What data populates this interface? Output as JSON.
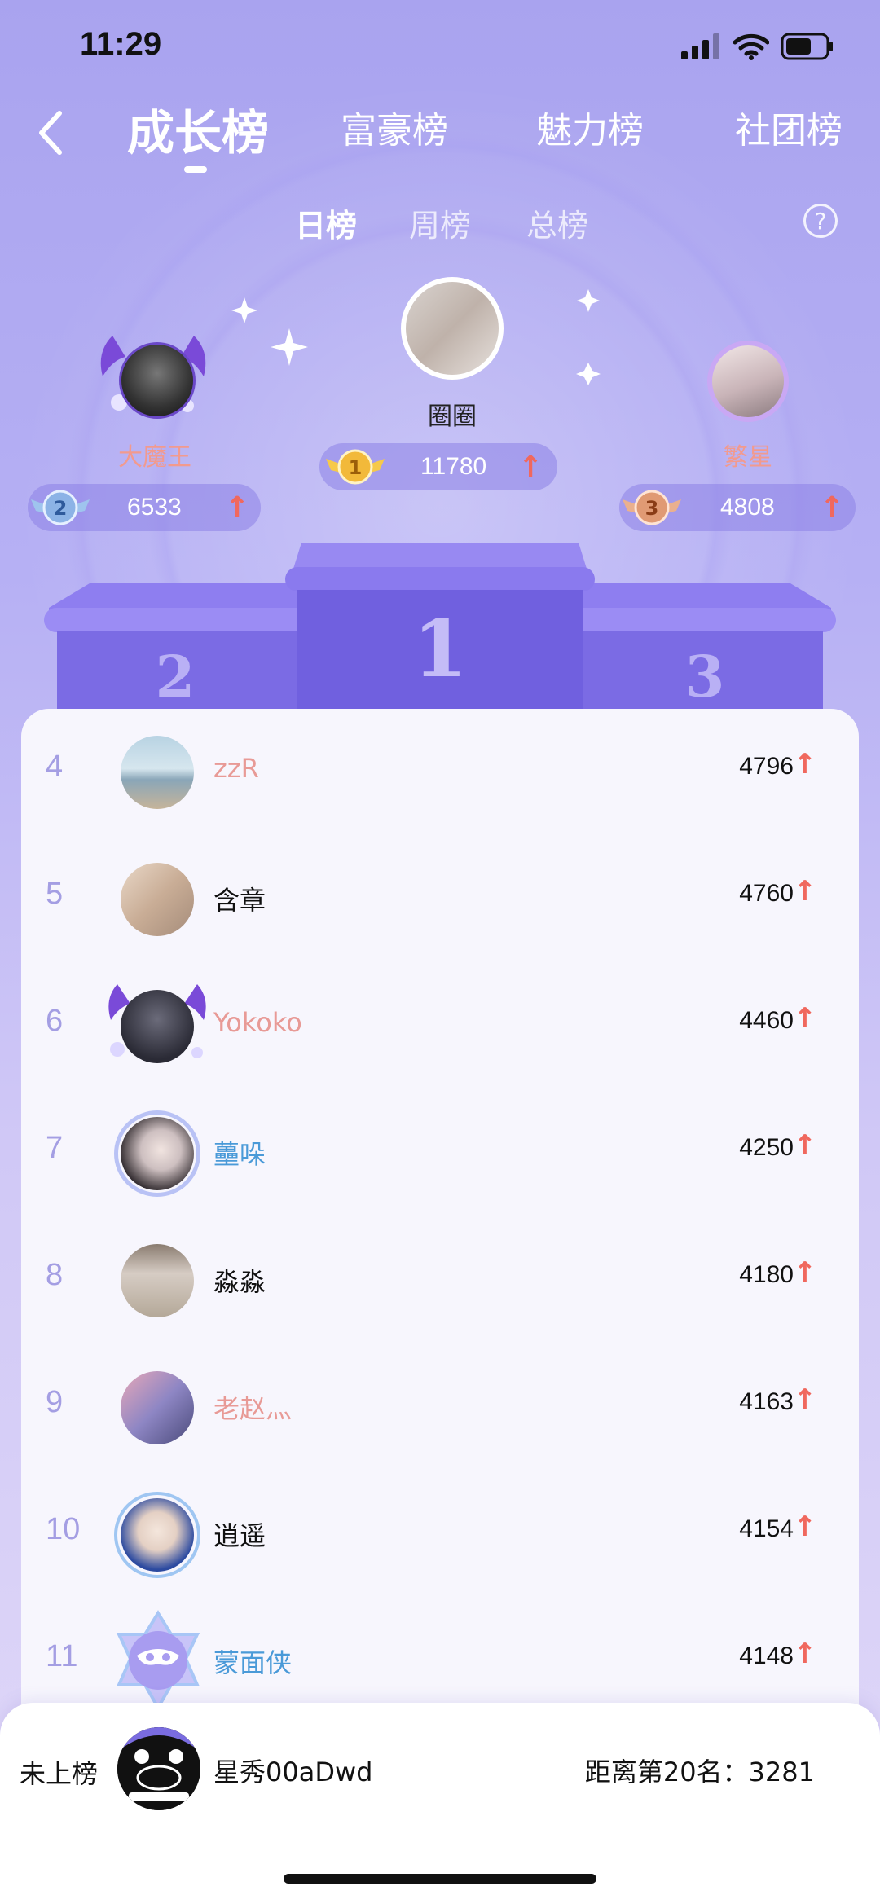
{
  "status_bar": {
    "time": "11:29",
    "icons": [
      "signal-icon",
      "wifi-icon",
      "battery-icon"
    ]
  },
  "nav": {
    "tabs": [
      {
        "label": "成长榜",
        "active": true
      },
      {
        "label": "富豪榜",
        "active": false
      },
      {
        "label": "魅力榜",
        "active": false
      },
      {
        "label": "社团榜",
        "active": false
      }
    ]
  },
  "sub_tabs": [
    {
      "label": "日榜",
      "active": true
    },
    {
      "label": "周榜",
      "active": false
    },
    {
      "label": "总榜",
      "active": false
    }
  ],
  "help": "?",
  "top3": [
    {
      "rank": "1",
      "name": "圈圈",
      "score": "11780",
      "name_color": "#ffffff"
    },
    {
      "rank": "2",
      "name": "大魔王",
      "score": "6533",
      "name_color": "#f29a8e"
    },
    {
      "rank": "3",
      "name": "繁星",
      "score": "4808",
      "name_color": "#f29a8e"
    }
  ],
  "podium": {
    "first": "1",
    "second": "2",
    "third": "3"
  },
  "list": [
    {
      "rank": "4",
      "name": "zzR",
      "score": "4796",
      "name_color": "#e89a96"
    },
    {
      "rank": "5",
      "name": "含章",
      "score": "4760",
      "name_color": "#111111"
    },
    {
      "rank": "6",
      "name": "Yokoko",
      "score": "4460",
      "name_color": "#e89a96"
    },
    {
      "rank": "7",
      "name": "蘲哚",
      "score": "4250",
      "name_color": "#4a9ad8"
    },
    {
      "rank": "8",
      "name": "淼淼",
      "score": "4180",
      "name_color": "#111111"
    },
    {
      "rank": "9",
      "name": "老赵灬",
      "score": "4163",
      "name_color": "#e89a96"
    },
    {
      "rank": "10",
      "name": "逍遥",
      "score": "4154",
      "name_color": "#111111"
    },
    {
      "rank": "11",
      "name": "蒙面侠",
      "score": "4148",
      "name_color": "#4a9ad8"
    }
  ],
  "arrow": "↑",
  "me": {
    "label": "未上榜",
    "name": "星秀00aDwd",
    "gap": "距离第20名：3281"
  },
  "colors": {
    "accent": "#8f86ea",
    "up_arrow": "#f0685e",
    "rank_number": "#a49ee3"
  }
}
